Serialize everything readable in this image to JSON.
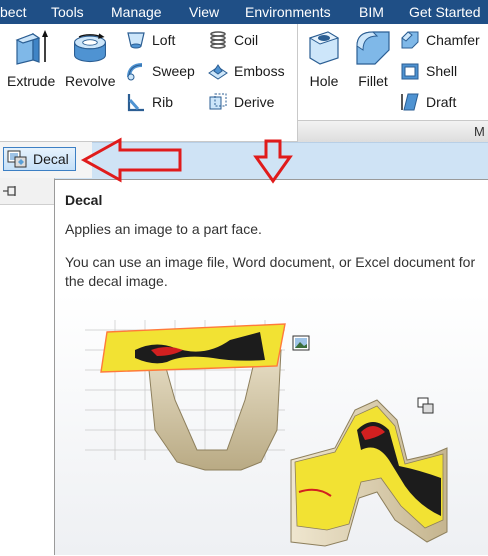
{
  "menubar": {
    "items": [
      "bect",
      "Tools",
      "Manage",
      "View",
      "Environments",
      "BIM",
      "Get Started"
    ]
  },
  "ribbon": {
    "create": {
      "extrude_label": "Extrude",
      "revolve_label": "Revolve",
      "loft_label": "Loft",
      "sweep_label": "Sweep",
      "rib_label": "Rib",
      "coil_label": "Coil",
      "emboss_label": "Emboss",
      "derive_label": "Derive"
    },
    "modify": {
      "hole_label": "Hole",
      "fillet_label": "Fillet",
      "chamfer_label": "Chamfer",
      "shell_label": "Shell",
      "draft_label": "Draft",
      "panel_label": "M"
    }
  },
  "decal_button": {
    "label": "Decal"
  },
  "tooltip": {
    "title": "Decal",
    "summary": "Applies an image to a part face.",
    "detail": "You can use an image file, Word document, or Excel document for the decal image."
  },
  "colors": {
    "menubar_bg": "#1f4f86",
    "strip_bg": "#cfe3f5",
    "arrow_red": "#e01b1b",
    "decal_yellow": "#f2e233",
    "part_tan": "#d6c9a8"
  },
  "icons": {
    "extrude": "extrude-icon",
    "revolve": "revolve-icon",
    "loft": "loft-icon",
    "sweep": "sweep-icon",
    "rib": "rib-icon",
    "coil": "coil-icon",
    "emboss": "emboss-icon",
    "derive": "derive-icon",
    "hole": "hole-icon",
    "fillet": "fillet-icon",
    "chamfer": "chamfer-icon",
    "shell": "shell-icon",
    "draft": "draft-icon",
    "decal": "decal-icon",
    "pin": "pin-icon"
  }
}
